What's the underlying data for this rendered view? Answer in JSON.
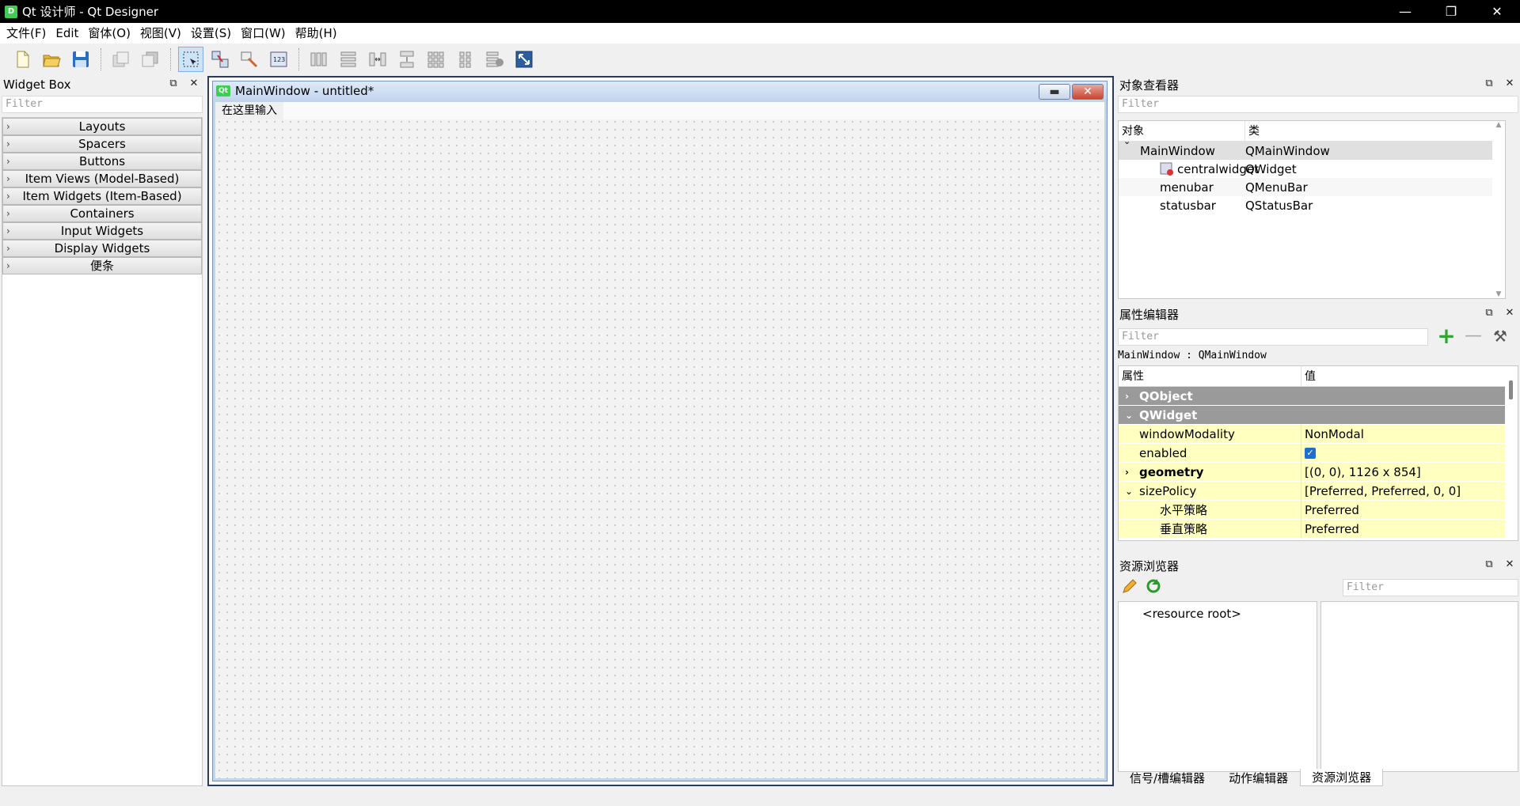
{
  "window": {
    "icon_letter": "D",
    "title": "Qt 设计师 - Qt Designer",
    "minimize": "—",
    "restore": "❐",
    "close": "✕"
  },
  "menubar": [
    "文件(F)",
    "Edit",
    "窗体(O)",
    "视图(V)",
    "设置(S)",
    "窗口(W)",
    "帮助(H)"
  ],
  "toolbar": {
    "icons": [
      "new-file-icon",
      "open-folder-icon",
      "save-icon",
      "bring-to-front-icon",
      "send-to-back-icon",
      "edit-widgets-icon",
      "edit-signals-slots-icon",
      "edit-buddies-icon",
      "edit-tab-order-icon",
      "layout-horizontal-icon",
      "layout-vertical-icon",
      "layout-horizontal-splitter-icon",
      "layout-vertical-splitter-icon",
      "layout-grid-icon",
      "layout-form-icon",
      "break-layout-icon",
      "adjust-size-icon"
    ]
  },
  "widget_box": {
    "title": "Widget Box",
    "filter_placeholder": "Filter",
    "categories": [
      "Layouts",
      "Spacers",
      "Buttons",
      "Item Views (Model-Based)",
      "Item Widgets (Item-Based)",
      "Containers",
      "Input Widgets",
      "Display Widgets",
      "便条"
    ]
  },
  "subwindow": {
    "icon_text": "Qt",
    "title": "MainWindow - untitled*",
    "form_menu_placeholder": "在这里输入"
  },
  "object_inspector": {
    "title": "对象查看器",
    "filter_placeholder": "Filter",
    "col_object": "对象",
    "col_class": "类",
    "rows": [
      {
        "object": "MainWindow",
        "class": "QMainWindow"
      },
      {
        "object": "centralwidget",
        "class": "QWidget"
      },
      {
        "object": "menubar",
        "class": "QMenuBar"
      },
      {
        "object": "statusbar",
        "class": "QStatusBar"
      }
    ]
  },
  "property_editor": {
    "title": "属性编辑器",
    "filter_placeholder": "Filter",
    "object_label": "MainWindow : QMainWindow",
    "col_property": "属性",
    "col_value": "值",
    "groups": [
      "QObject",
      "QWidget"
    ],
    "rows": [
      {
        "name": "windowModality",
        "value": "NonModal"
      },
      {
        "name": "enabled",
        "value": "✓"
      },
      {
        "name": "geometry",
        "value": "[(0, 0), 1126 x 854]"
      },
      {
        "name": "sizePolicy",
        "value": "[Preferred, Preferred, 0, 0]"
      },
      {
        "name": "水平策略",
        "value": "Preferred"
      },
      {
        "name": "垂直策略",
        "value": "Preferred"
      }
    ]
  },
  "resource_browser": {
    "title": "资源浏览器",
    "filter_placeholder": "Filter",
    "root": "<resource root>"
  },
  "bottom_tabs": [
    "信号/槽编辑器",
    "动作编辑器",
    "资源浏览器"
  ],
  "colors": {
    "group_header": "#9a9a9a",
    "property_row": "#ffffc0",
    "accent_check": "#1f6fd0",
    "qt_green": "#41cd52"
  }
}
